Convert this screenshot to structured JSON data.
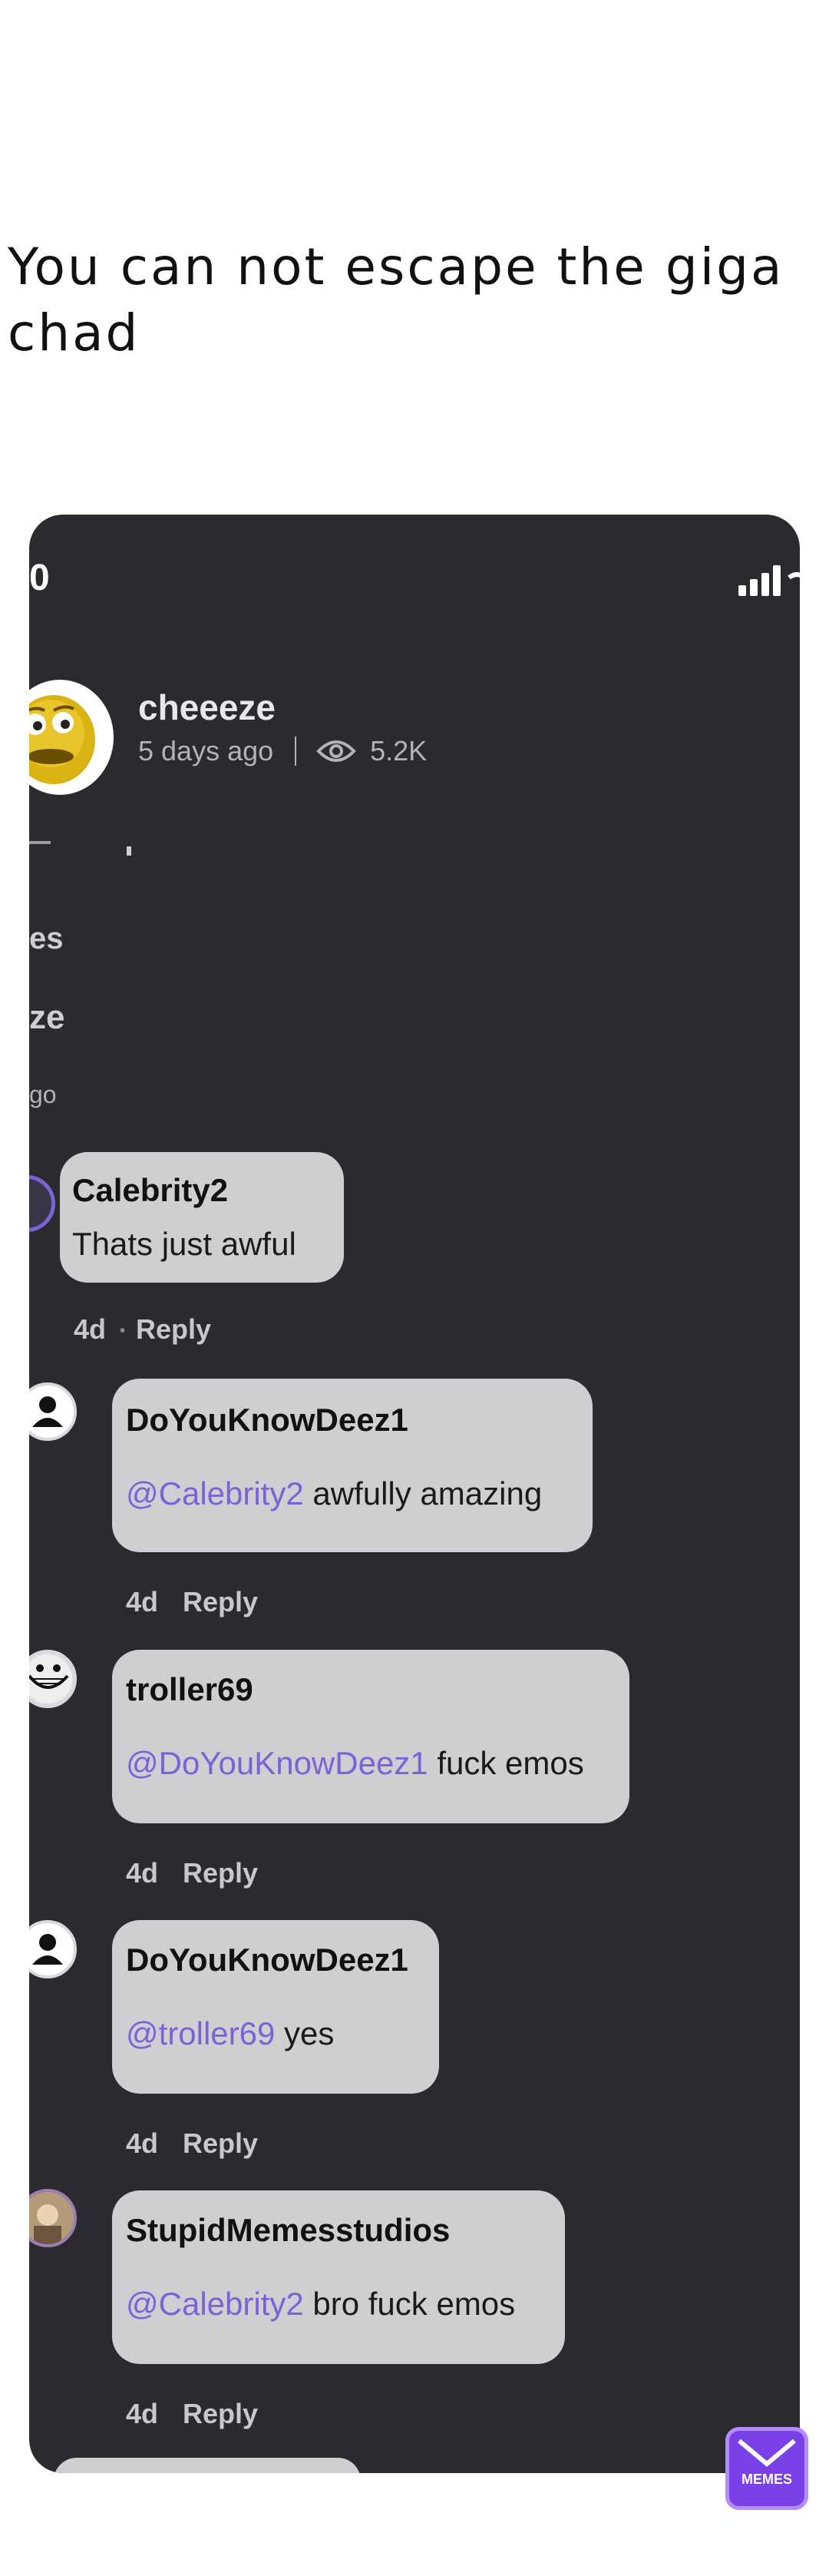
{
  "caption": "You can not escape the giga chad",
  "status_bar": {
    "time": "0"
  },
  "post": {
    "author": "cheeeze",
    "time_ago": "5 days ago",
    "views": "5.2K"
  },
  "fragments": {
    "line1": "es",
    "line2": "ze",
    "line3": "go"
  },
  "comments": [
    {
      "username": "Calebrity2",
      "mention": "",
      "text": "Thats just awful",
      "age": "4d",
      "reply": "Reply"
    },
    {
      "username": "DoYouKnowDeez1",
      "mention": "@Calebrity2",
      "text": " awfully amazing",
      "age": "4d",
      "reply": "Reply"
    },
    {
      "username": "troller69",
      "mention": "@DoYouKnowDeez1",
      "text": " fuck emos",
      "age": "4d",
      "reply": "Reply"
    },
    {
      "username": "DoYouKnowDeez1",
      "mention": "@troller69",
      "text": " yes",
      "age": "4d",
      "reply": "Reply"
    },
    {
      "username": "StupidMemesstudios",
      "mention": "@Calebrity2",
      "text": " bro fuck emos",
      "age": "4d",
      "reply": "Reply"
    }
  ],
  "watermark": {
    "label": "MEMES"
  },
  "colors": {
    "phone_bg": "#2b2a2e",
    "bubble": "#cfcfd2",
    "mention": "#7b62d6",
    "logo": "#7a42e6"
  }
}
